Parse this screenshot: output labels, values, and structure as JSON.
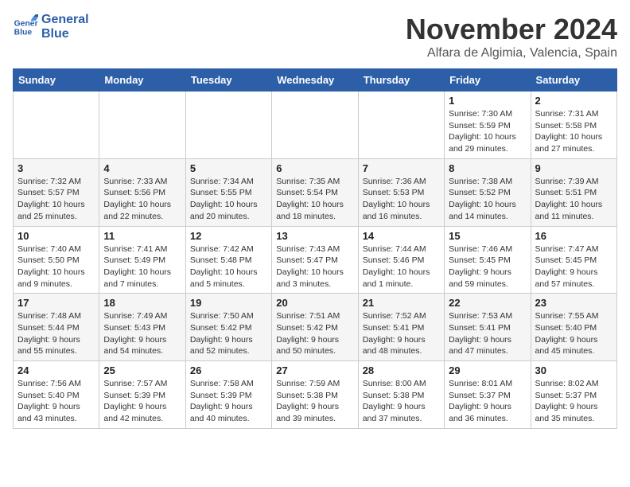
{
  "logo": {
    "line1": "General",
    "line2": "Blue"
  },
  "header": {
    "month": "November 2024",
    "location": "Alfara de Algimia, Valencia, Spain"
  },
  "weekdays": [
    "Sunday",
    "Monday",
    "Tuesday",
    "Wednesday",
    "Thursday",
    "Friday",
    "Saturday"
  ],
  "weeks": [
    [
      {
        "day": "",
        "info": ""
      },
      {
        "day": "",
        "info": ""
      },
      {
        "day": "",
        "info": ""
      },
      {
        "day": "",
        "info": ""
      },
      {
        "day": "",
        "info": ""
      },
      {
        "day": "1",
        "info": "Sunrise: 7:30 AM\nSunset: 5:59 PM\nDaylight: 10 hours and 29 minutes."
      },
      {
        "day": "2",
        "info": "Sunrise: 7:31 AM\nSunset: 5:58 PM\nDaylight: 10 hours and 27 minutes."
      }
    ],
    [
      {
        "day": "3",
        "info": "Sunrise: 7:32 AM\nSunset: 5:57 PM\nDaylight: 10 hours and 25 minutes."
      },
      {
        "day": "4",
        "info": "Sunrise: 7:33 AM\nSunset: 5:56 PM\nDaylight: 10 hours and 22 minutes."
      },
      {
        "day": "5",
        "info": "Sunrise: 7:34 AM\nSunset: 5:55 PM\nDaylight: 10 hours and 20 minutes."
      },
      {
        "day": "6",
        "info": "Sunrise: 7:35 AM\nSunset: 5:54 PM\nDaylight: 10 hours and 18 minutes."
      },
      {
        "day": "7",
        "info": "Sunrise: 7:36 AM\nSunset: 5:53 PM\nDaylight: 10 hours and 16 minutes."
      },
      {
        "day": "8",
        "info": "Sunrise: 7:38 AM\nSunset: 5:52 PM\nDaylight: 10 hours and 14 minutes."
      },
      {
        "day": "9",
        "info": "Sunrise: 7:39 AM\nSunset: 5:51 PM\nDaylight: 10 hours and 11 minutes."
      }
    ],
    [
      {
        "day": "10",
        "info": "Sunrise: 7:40 AM\nSunset: 5:50 PM\nDaylight: 10 hours and 9 minutes."
      },
      {
        "day": "11",
        "info": "Sunrise: 7:41 AM\nSunset: 5:49 PM\nDaylight: 10 hours and 7 minutes."
      },
      {
        "day": "12",
        "info": "Sunrise: 7:42 AM\nSunset: 5:48 PM\nDaylight: 10 hours and 5 minutes."
      },
      {
        "day": "13",
        "info": "Sunrise: 7:43 AM\nSunset: 5:47 PM\nDaylight: 10 hours and 3 minutes."
      },
      {
        "day": "14",
        "info": "Sunrise: 7:44 AM\nSunset: 5:46 PM\nDaylight: 10 hours and 1 minute."
      },
      {
        "day": "15",
        "info": "Sunrise: 7:46 AM\nSunset: 5:45 PM\nDaylight: 9 hours and 59 minutes."
      },
      {
        "day": "16",
        "info": "Sunrise: 7:47 AM\nSunset: 5:45 PM\nDaylight: 9 hours and 57 minutes."
      }
    ],
    [
      {
        "day": "17",
        "info": "Sunrise: 7:48 AM\nSunset: 5:44 PM\nDaylight: 9 hours and 55 minutes."
      },
      {
        "day": "18",
        "info": "Sunrise: 7:49 AM\nSunset: 5:43 PM\nDaylight: 9 hours and 54 minutes."
      },
      {
        "day": "19",
        "info": "Sunrise: 7:50 AM\nSunset: 5:42 PM\nDaylight: 9 hours and 52 minutes."
      },
      {
        "day": "20",
        "info": "Sunrise: 7:51 AM\nSunset: 5:42 PM\nDaylight: 9 hours and 50 minutes."
      },
      {
        "day": "21",
        "info": "Sunrise: 7:52 AM\nSunset: 5:41 PM\nDaylight: 9 hours and 48 minutes."
      },
      {
        "day": "22",
        "info": "Sunrise: 7:53 AM\nSunset: 5:41 PM\nDaylight: 9 hours and 47 minutes."
      },
      {
        "day": "23",
        "info": "Sunrise: 7:55 AM\nSunset: 5:40 PM\nDaylight: 9 hours and 45 minutes."
      }
    ],
    [
      {
        "day": "24",
        "info": "Sunrise: 7:56 AM\nSunset: 5:40 PM\nDaylight: 9 hours and 43 minutes."
      },
      {
        "day": "25",
        "info": "Sunrise: 7:57 AM\nSunset: 5:39 PM\nDaylight: 9 hours and 42 minutes."
      },
      {
        "day": "26",
        "info": "Sunrise: 7:58 AM\nSunset: 5:39 PM\nDaylight: 9 hours and 40 minutes."
      },
      {
        "day": "27",
        "info": "Sunrise: 7:59 AM\nSunset: 5:38 PM\nDaylight: 9 hours and 39 minutes."
      },
      {
        "day": "28",
        "info": "Sunrise: 8:00 AM\nSunset: 5:38 PM\nDaylight: 9 hours and 37 minutes."
      },
      {
        "day": "29",
        "info": "Sunrise: 8:01 AM\nSunset: 5:37 PM\nDaylight: 9 hours and 36 minutes."
      },
      {
        "day": "30",
        "info": "Sunrise: 8:02 AM\nSunset: 5:37 PM\nDaylight: 9 hours and 35 minutes."
      }
    ]
  ]
}
